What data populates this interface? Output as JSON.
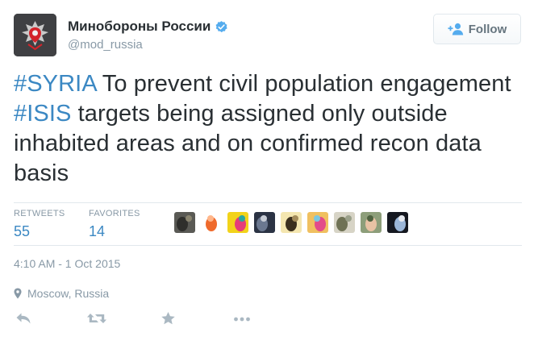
{
  "author": {
    "display_name": "Минобороны России",
    "handle": "@mod_russia",
    "verified": true,
    "avatar_icon": "emblem-icon"
  },
  "follow_button": {
    "label": "Follow",
    "icon": "add-user-icon"
  },
  "tweet": {
    "segments": [
      {
        "text": "#SYRIA",
        "type": "hashtag"
      },
      {
        "text": " To prevent civil population engagement ",
        "type": "text"
      },
      {
        "text": "#ISIS",
        "type": "hashtag"
      },
      {
        "text": " targets being assigned only outside inhabited areas and on confirmed recon data basis",
        "type": "text"
      }
    ]
  },
  "stats": {
    "retweets_label": "RETWEETS",
    "retweets_value": "55",
    "favorites_label": "FAVORITES",
    "favorites_value": "14"
  },
  "favoriters": [
    {
      "name": "user-1",
      "colors": [
        "#5a5a55",
        "#2f2f2c",
        "#8a8570"
      ]
    },
    {
      "name": "user-2",
      "colors": [
        "#ffffff",
        "#ef6a2c",
        "#ffb68a"
      ]
    },
    {
      "name": "user-3",
      "colors": [
        "#f2d31a",
        "#e53d7a",
        "#2aa7a0"
      ]
    },
    {
      "name": "user-4",
      "colors": [
        "#2b3344",
        "#6b7890",
        "#c8cdd6"
      ]
    },
    {
      "name": "user-5",
      "colors": [
        "#f4e6b0",
        "#3b2f1e",
        "#a48c5a"
      ]
    },
    {
      "name": "user-6",
      "colors": [
        "#f0c060",
        "#e34b8a",
        "#7ac7e0"
      ]
    },
    {
      "name": "user-7",
      "colors": [
        "#d7d4c6",
        "#6f7255",
        "#9aa08a"
      ]
    },
    {
      "name": "user-8",
      "colors": [
        "#8d9e7a",
        "#e8c2a4",
        "#4e6240"
      ]
    },
    {
      "name": "user-9",
      "colors": [
        "#151820",
        "#9bb6d8",
        "#e6e9ef"
      ]
    }
  ],
  "timestamp": "4:10 AM - 1 Oct 2015",
  "location": "Moscow, Russia",
  "colors": {
    "link": "#3b88c3",
    "muted": "#8899a6",
    "text": "#292f33",
    "verified": "#55acee"
  }
}
